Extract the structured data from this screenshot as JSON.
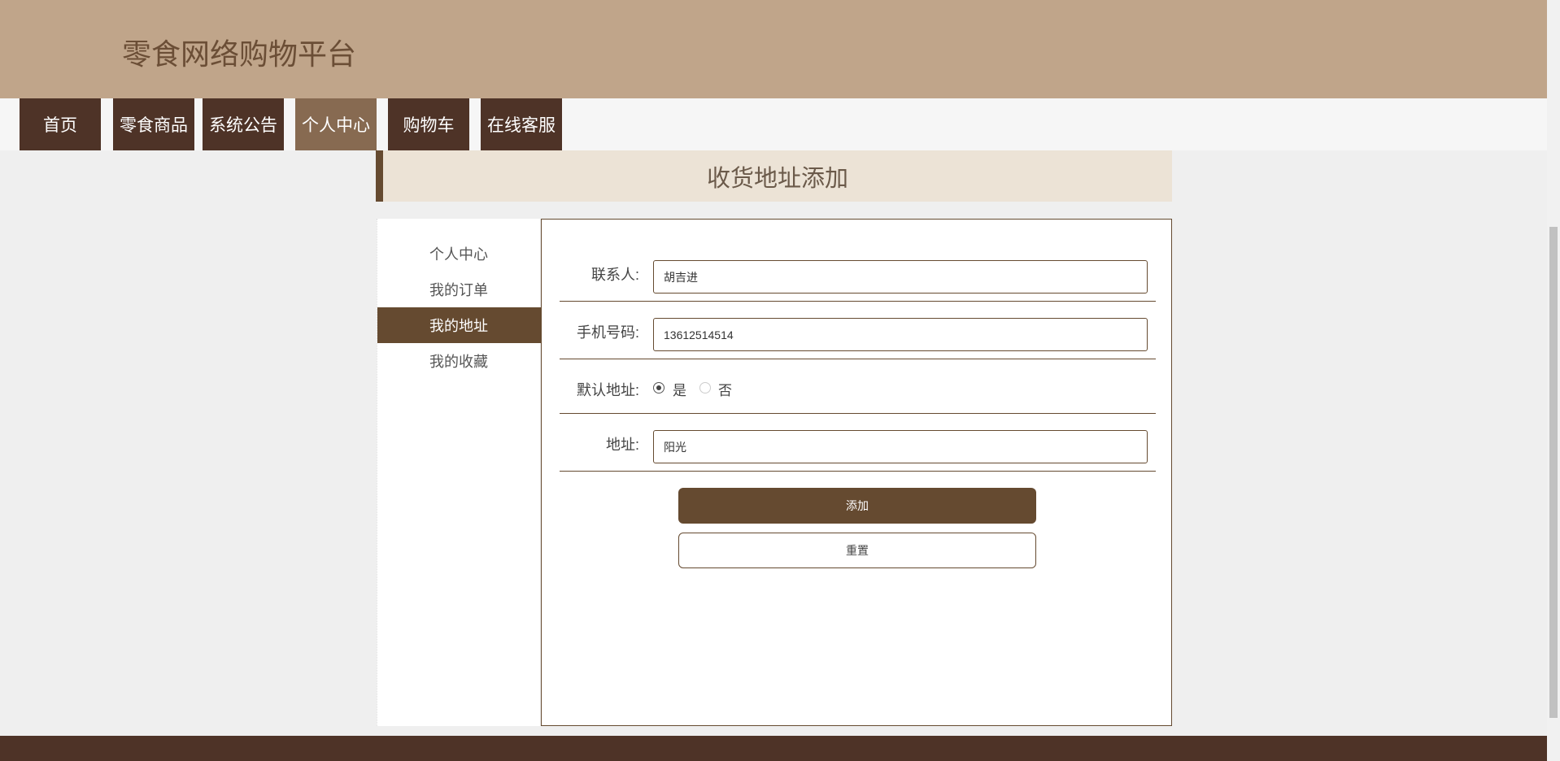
{
  "header": {
    "title": "零食网络购物平台"
  },
  "nav": {
    "items": [
      {
        "label": "首页"
      },
      {
        "label": "零食商品"
      },
      {
        "label": "系统公告"
      },
      {
        "label": "个人中心",
        "active": true
      },
      {
        "label": "购物车"
      },
      {
        "label": "在线客服"
      }
    ]
  },
  "banner": {
    "title": "收货地址添加"
  },
  "sidebar": {
    "items": [
      {
        "label": "个人中心"
      },
      {
        "label": "我的订单"
      },
      {
        "label": "我的地址",
        "active": true
      },
      {
        "label": "我的收藏"
      }
    ]
  },
  "form": {
    "contact": {
      "label": "联系人:",
      "value": "胡吉进"
    },
    "phone": {
      "label": "手机号码:",
      "value": "13612514514"
    },
    "default": {
      "label": "默认地址:",
      "options": [
        "是",
        "否"
      ],
      "selected": "是"
    },
    "address": {
      "label": "地址:",
      "value": "阳光"
    },
    "add_label": "添加",
    "reset_label": "重置"
  },
  "colors": {
    "header": "#c0a58a",
    "nav": "#4e3327",
    "accent": "#654a30",
    "banner": "#ece3d6"
  }
}
